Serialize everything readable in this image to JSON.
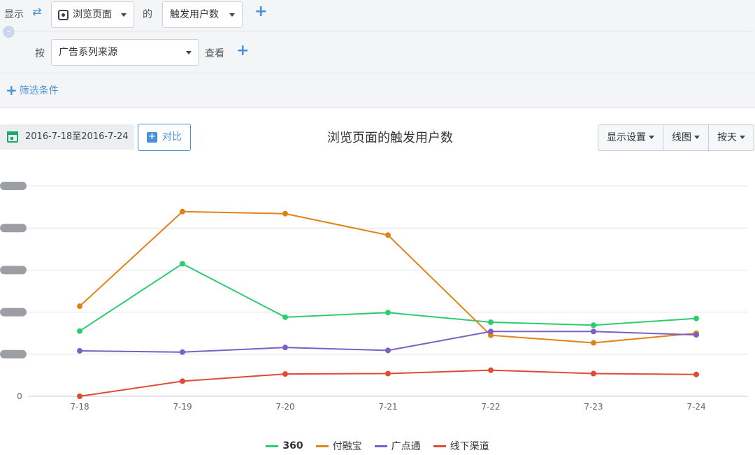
{
  "query": {
    "show_label": "显示",
    "event_value": "浏览页面",
    "of_label": "的",
    "metric_value": "触发用户数",
    "by_label": "按",
    "group_value": "广告系列来源",
    "view_label": "查看",
    "filter_label": "筛选条件"
  },
  "toolbar": {
    "date_range": "2016-7-18至2016-7-24",
    "compare_label": "对比",
    "display_settings_label": "显示设置",
    "chart_type_label": "线图",
    "interval_label": "按天"
  },
  "colors": {
    "accent": "#4a90d9",
    "s360": "#2ecc71",
    "fu": "#e08216",
    "gdt": "#7b5fc6",
    "xx": "#e04b34"
  },
  "chart_data": {
    "type": "line",
    "title": "浏览页面的触发用户数",
    "xlabel": "",
    "ylabel": "",
    "categories": [
      "7-18",
      "7-19",
      "7-20",
      "7-21",
      "7-22",
      "7-23",
      "7-24"
    ],
    "y_tick_labels": [
      "0"
    ],
    "ylim": [
      0,
      5
    ],
    "grid": true,
    "legend_position": "bottom",
    "series": [
      {
        "name": "360",
        "color": "#2ecc71",
        "values": [
          1.55,
          3.15,
          1.88,
          1.99,
          1.76,
          1.69,
          1.85
        ]
      },
      {
        "name": "付融宝",
        "color": "#e08216",
        "values": [
          2.14,
          4.39,
          4.34,
          3.83,
          1.45,
          1.27,
          1.5
        ]
      },
      {
        "name": "广点通",
        "color": "#7b5fc6",
        "values": [
          1.08,
          1.05,
          1.16,
          1.09,
          1.54,
          1.54,
          1.46
        ]
      },
      {
        "name": "线下渠道",
        "color": "#e04b34",
        "values": [
          0.0,
          0.36,
          0.53,
          0.54,
          0.62,
          0.54,
          0.52
        ]
      }
    ]
  }
}
